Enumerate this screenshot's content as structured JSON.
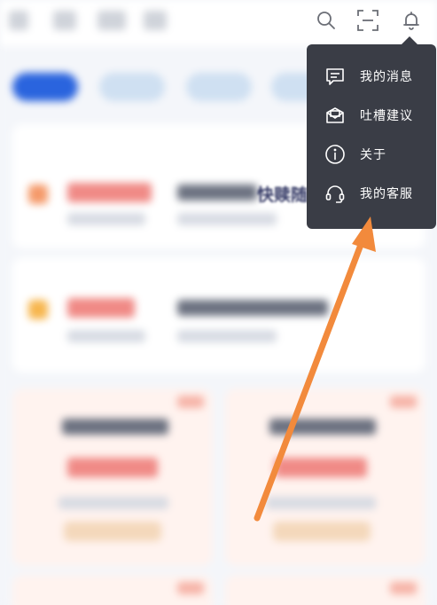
{
  "header": {
    "icons": [
      "search-icon",
      "scan-icon",
      "bell-icon"
    ]
  },
  "background": {
    "promo_text": "快赎随心"
  },
  "menu": {
    "items": [
      {
        "icon": "message-icon",
        "label": "我的消息"
      },
      {
        "icon": "feedback-icon",
        "label": "吐槽建议"
      },
      {
        "icon": "info-icon",
        "label": "关于"
      },
      {
        "icon": "headset-icon",
        "label": "我的客服"
      }
    ]
  },
  "colors": {
    "menu_bg": "#3a3d46",
    "accent_blue": "#2a64de",
    "annotation_arrow": "#f28a3c"
  }
}
